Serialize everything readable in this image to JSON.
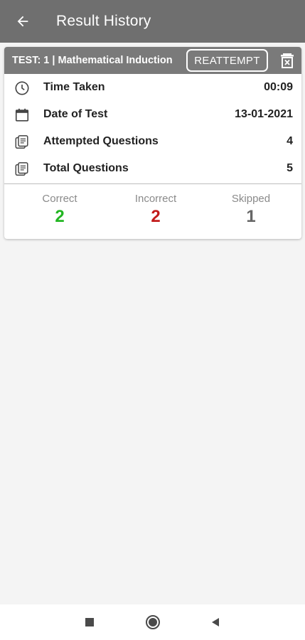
{
  "header": {
    "title": "Result History",
    "back_icon": "back-arrow-icon"
  },
  "card": {
    "test_title": "TEST: 1 | Mathematical Induction",
    "reattempt_label": "REATTEMPT",
    "delete_icon": "delete-icon",
    "rows": [
      {
        "icon": "clock-icon",
        "label": "Time Taken",
        "value": "00:09"
      },
      {
        "icon": "calendar-icon",
        "label": "Date of Test",
        "value": "13-01-2021"
      },
      {
        "icon": "questions-icon",
        "label": "Attempted Questions",
        "value": "4"
      },
      {
        "icon": "questions-icon",
        "label": "Total Questions",
        "value": "5"
      }
    ],
    "stats": {
      "correct": {
        "label": "Correct",
        "value": "2",
        "color": "#22b622"
      },
      "incorrect": {
        "label": "Incorrect",
        "value": "2",
        "color": "#c21b1b"
      },
      "skipped": {
        "label": "Skipped",
        "value": "1",
        "color": "#666666"
      }
    }
  },
  "colors": {
    "app_bar": "#6f6f6f",
    "card_header": "#7a7a7a",
    "background": "#f4f4f4"
  },
  "nav": {
    "recents_icon": "square-icon",
    "home_icon": "circle-icon",
    "back_icon": "triangle-back-icon"
  }
}
